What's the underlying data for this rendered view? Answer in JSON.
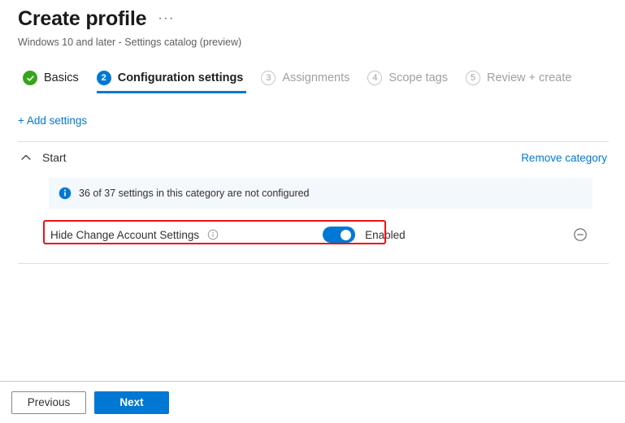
{
  "header": {
    "title": "Create profile",
    "ellipsis": "···",
    "subtitle": "Windows 10 and later - Settings catalog (preview)"
  },
  "wizard": {
    "tabs": [
      {
        "step": "1",
        "label": "Basics",
        "state": "complete"
      },
      {
        "step": "2",
        "label": "Configuration settings",
        "state": "current"
      },
      {
        "step": "3",
        "label": "Assignments",
        "state": "pending"
      },
      {
        "step": "4",
        "label": "Scope tags",
        "state": "pending"
      },
      {
        "step": "5",
        "label": "Review + create",
        "state": "pending"
      }
    ]
  },
  "actions": {
    "add_settings_label": "+ Add settings"
  },
  "category": {
    "name": "Start",
    "remove_label": "Remove category",
    "collapse_icon": "chevron-up-icon",
    "info_banner": {
      "icon": "info-icon",
      "text": "36 of 37 settings in this category are not configured"
    },
    "settings": [
      {
        "label": "Hide Change Account Settings",
        "info_icon": "info-icon",
        "toggle_on": true,
        "state_label": "Enabled",
        "remove_icon": "remove-circle-icon",
        "highlighted": true
      }
    ]
  },
  "footer": {
    "previous_label": "Previous",
    "next_label": "Next"
  },
  "colors": {
    "accent": "#0078d4",
    "complete": "#37a51c",
    "highlight": "#ee1111",
    "banner_bg": "#f3f8fd"
  }
}
